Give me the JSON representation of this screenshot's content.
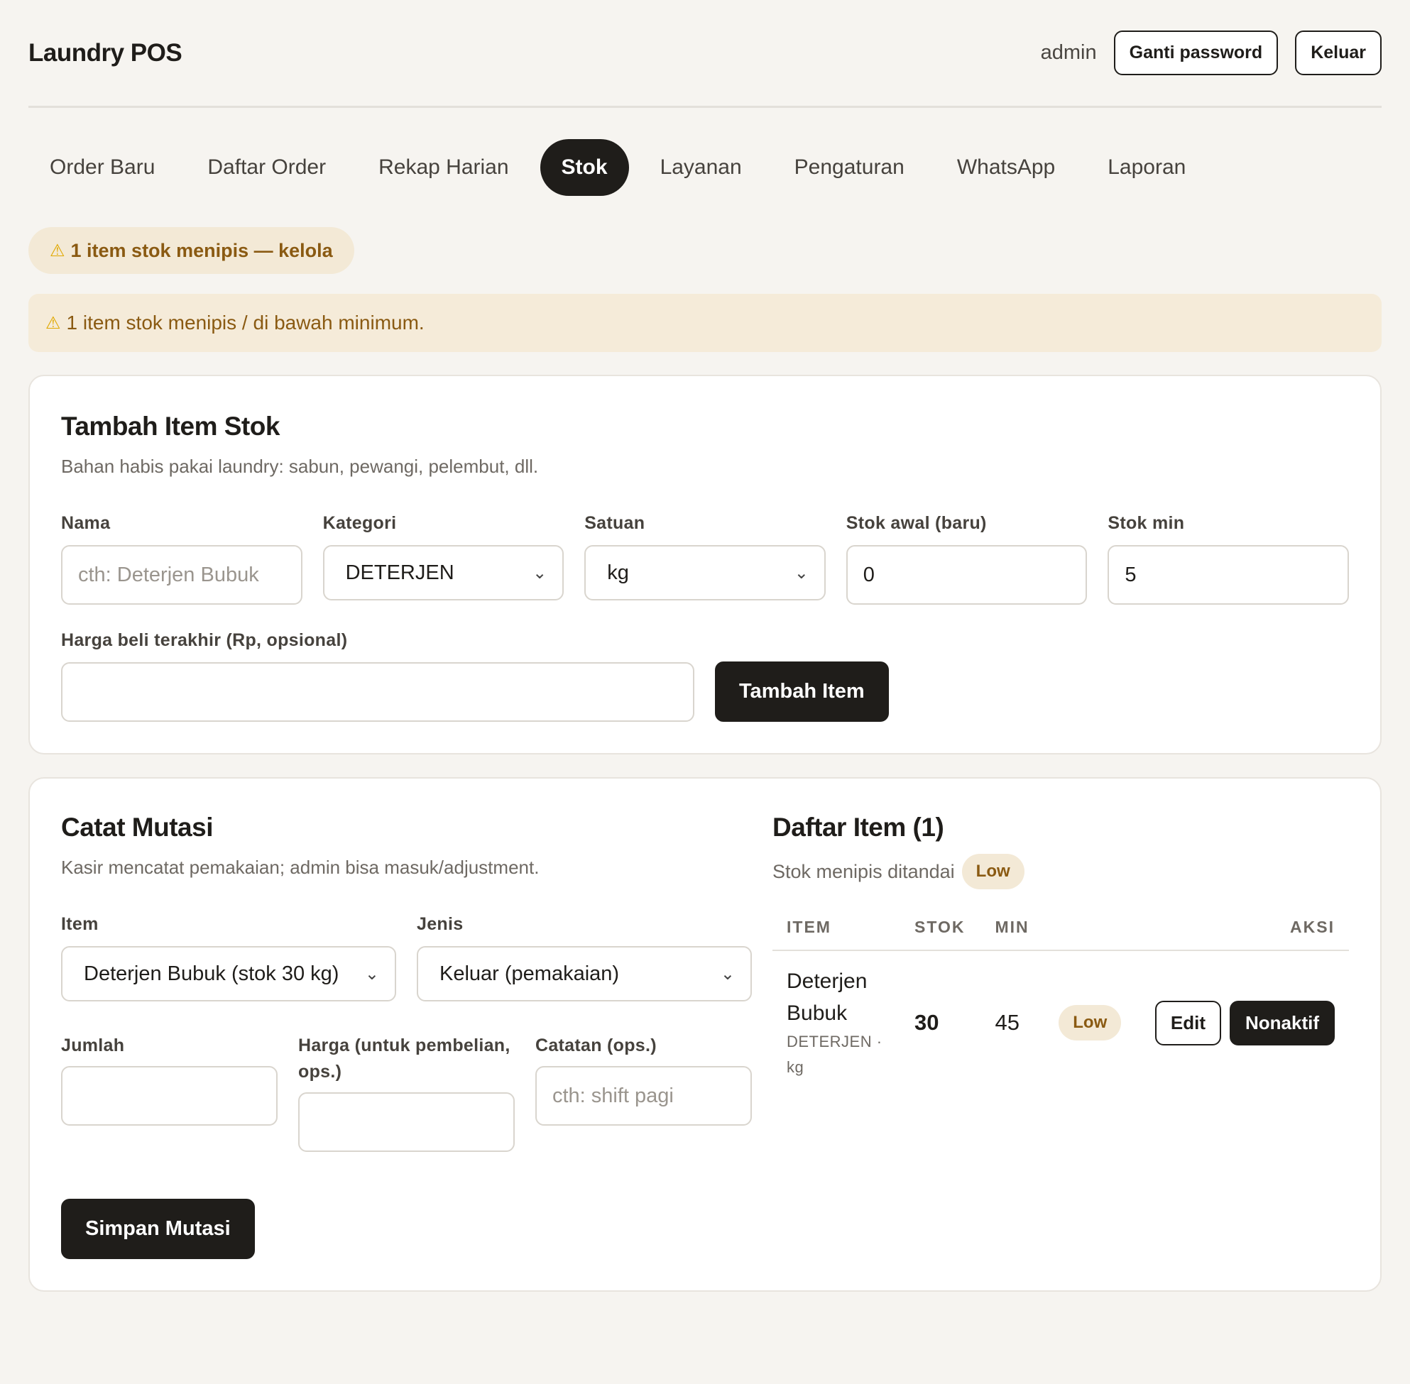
{
  "header": {
    "app_title": "Laundry POS",
    "user": "admin",
    "change_password": "Ganti password",
    "logout": "Keluar"
  },
  "tabs": [
    {
      "label": "Order Baru",
      "active": false
    },
    {
      "label": "Daftar Order",
      "active": false
    },
    {
      "label": "Rekap Harian",
      "active": false
    },
    {
      "label": "Stok",
      "active": true
    },
    {
      "label": "Layanan",
      "active": false
    },
    {
      "label": "Pengaturan",
      "active": false
    },
    {
      "label": "WhatsApp",
      "active": false
    },
    {
      "label": "Laporan",
      "active": false
    }
  ],
  "alerts": {
    "pill": "1 item stok menipis — kelola",
    "banner": "1 item stok menipis / di bawah minimum."
  },
  "add_item": {
    "title": "Tambah Item Stok",
    "subtitle": "Bahan habis pakai laundry: sabun, pewangi, pelembut, dll.",
    "name_label": "Nama",
    "name_placeholder": "cth: Deterjen Bubuk",
    "category_label": "Kategori",
    "category_value": "DETERJEN",
    "unit_label": "Satuan",
    "unit_value": "kg",
    "initial_stock_label": "Stok awal (baru)",
    "initial_stock_value": "0",
    "min_stock_label": "Stok min",
    "min_stock_value": "5",
    "price_label": "Harga beli terakhir (Rp, opsional)",
    "price_value": "",
    "submit": "Tambah Item"
  },
  "mutation": {
    "title": "Catat Mutasi",
    "subtitle": "Kasir mencatat pemakaian; admin bisa masuk/adjustment.",
    "item_label": "Item",
    "item_value": "Deterjen Bubuk (stok 30 kg)",
    "type_label": "Jenis",
    "type_value": "Keluar (pemakaian)",
    "qty_label": "Jumlah",
    "price_label": "Harga (untuk pembelian, ops.)",
    "note_label": "Catatan (ops.)",
    "note_placeholder": "cth: shift pagi",
    "submit": "Simpan Mutasi"
  },
  "item_list": {
    "title": "Daftar Item (1)",
    "subtitle": "Stok menipis ditandai",
    "badge": "Low",
    "columns": {
      "item": "ITEM",
      "stock": "STOK",
      "min": "MIN",
      "action": "AKSI"
    },
    "rows": [
      {
        "name": "Deterjen Bubuk",
        "meta": "DETERJEN · kg",
        "stock": "30",
        "min": "45",
        "status": "Low",
        "edit": "Edit",
        "deactivate": "Nonaktif"
      }
    ]
  },
  "icons": {
    "warning": "warning-icon",
    "chevron": "chevron-down-icon"
  },
  "colors": {
    "primary": "#1f1d1a",
    "warning_bg": "#f3e9d6",
    "warning_text": "#8a5a12",
    "background": "#f6f4f0"
  }
}
